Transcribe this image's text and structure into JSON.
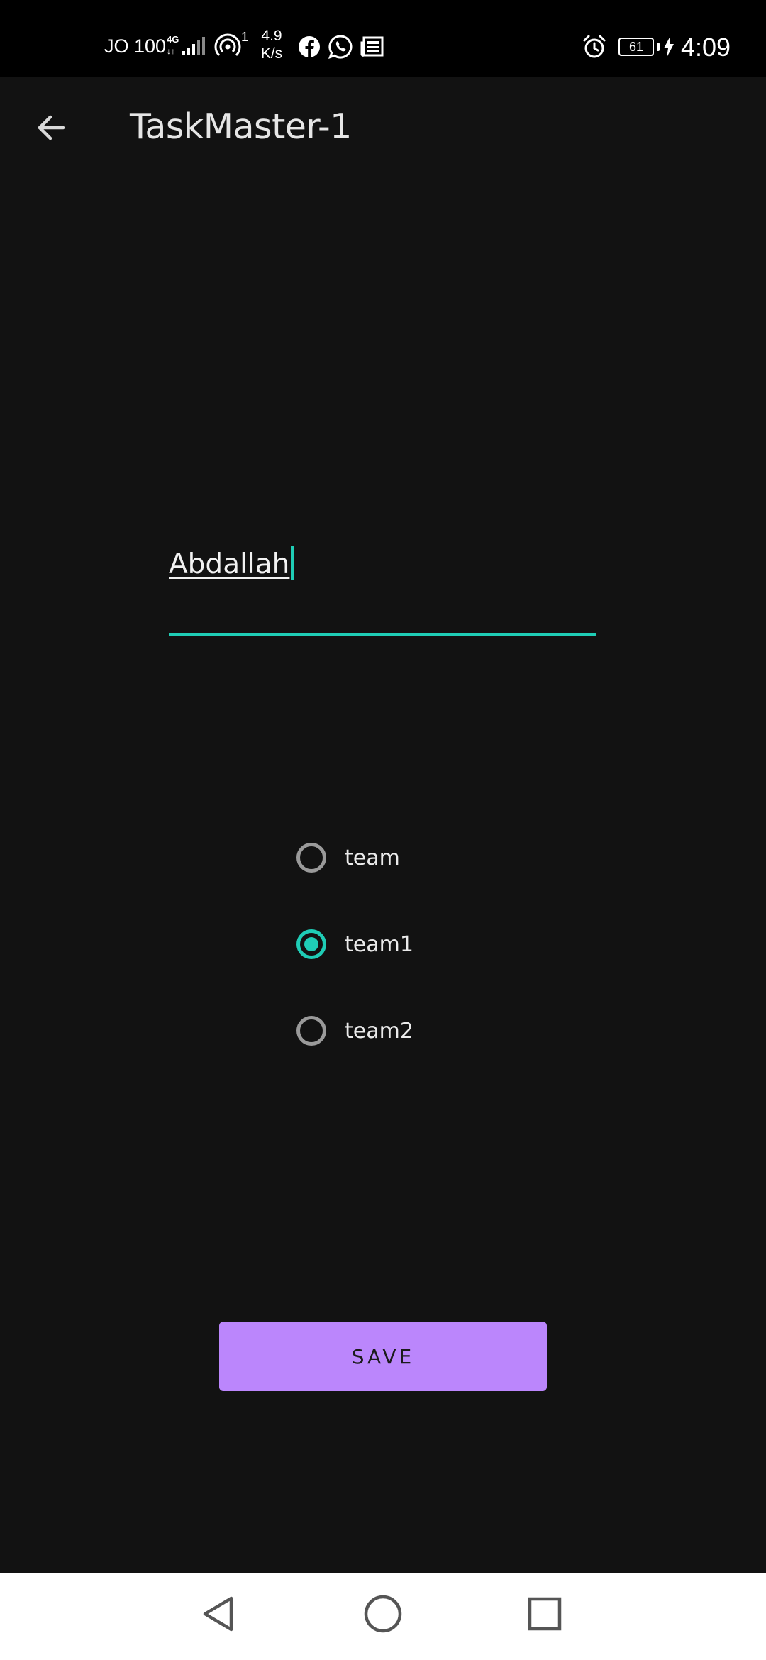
{
  "status_bar": {
    "carrier": "JO 100",
    "network_type": "4G",
    "hotspot_count": "1",
    "speed_value": "4.9",
    "speed_unit": "K/s",
    "battery_level": "61",
    "time": "4:09",
    "icons": [
      "signal-bars-icon",
      "hotspot-icon",
      "facebook-icon",
      "whatsapp-icon",
      "news-icon",
      "alarm-icon",
      "battery-icon",
      "charging-bolt-icon"
    ]
  },
  "app_bar": {
    "title": "TaskMaster-1",
    "back_icon": "arrow-left-icon"
  },
  "name_field": {
    "value": "Abdallah"
  },
  "teams": {
    "options": [
      {
        "label": "team",
        "checked": false
      },
      {
        "label": "team1",
        "checked": true
      },
      {
        "label": "team2",
        "checked": false
      }
    ]
  },
  "save_button": {
    "label": "SAVE"
  },
  "nav_bar": {
    "icons": [
      "back-triangle-icon",
      "home-circle-icon",
      "recents-square-icon"
    ]
  },
  "colors": {
    "background": "#121212",
    "status_bar": "#000000",
    "accent": "#1fcdb6",
    "button": "#bb86fc",
    "nav_bar": "#ffffff"
  }
}
